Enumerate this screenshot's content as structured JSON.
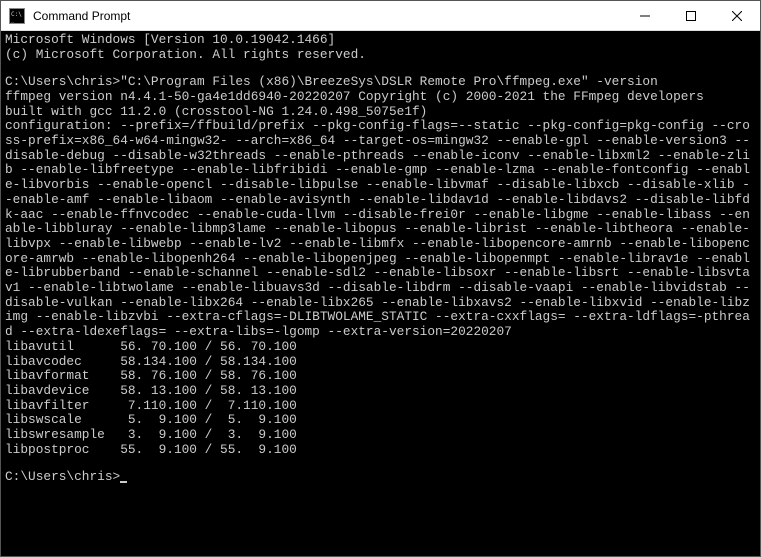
{
  "window": {
    "title": "Command Prompt",
    "icon_name": "cmd-icon"
  },
  "titlebar_controls": {
    "minimize": "minimize-button",
    "maximize": "maximize-button",
    "close": "close-button"
  },
  "terminal_lines": [
    "Microsoft Windows [Version 10.0.19042.1466]",
    "(c) Microsoft Corporation. All rights reserved.",
    "",
    "C:\\Users\\chris>\"C:\\Program Files (x86)\\BreezeSys\\DSLR Remote Pro\\ffmpeg.exe\" -version",
    "ffmpeg version n4.4.1-50-ga4e1dd6940-20220207 Copyright (c) 2000-2021 the FFmpeg developers",
    "built with gcc 11.2.0 (crosstool-NG 1.24.0.498_5075e1f)",
    "configuration: --prefix=/ffbuild/prefix --pkg-config-flags=--static --pkg-config=pkg-config --cross-prefix=x86_64-w64-mingw32- --arch=x86_64 --target-os=mingw32 --enable-gpl --enable-version3 --disable-debug --disable-w32threads --enable-pthreads --enable-iconv --enable-libxml2 --enable-zlib --enable-libfreetype --enable-libfribidi --enable-gmp --enable-lzma --enable-fontconfig --enable-libvorbis --enable-opencl --disable-libpulse --enable-libvmaf --disable-libxcb --disable-xlib --enable-amf --enable-libaom --enable-avisynth --enable-libdav1d --enable-libdavs2 --disable-libfdk-aac --enable-ffnvcodec --enable-cuda-llvm --disable-frei0r --enable-libgme --enable-libass --enable-libbluray --enable-libmp3lame --enable-libopus --enable-librist --enable-libtheora --enable-libvpx --enable-libwebp --enable-lv2 --enable-libmfx --enable-libopencore-amrnb --enable-libopencore-amrwb --enable-libopenh264 --enable-libopenjpeg --enable-libopenmpt --enable-librav1e --enable-librubberband --enable-schannel --enable-sdl2 --enable-libsoxr --enable-libsrt --enable-libsvtav1 --enable-libtwolame --enable-libuavs3d --disable-libdrm --disable-vaapi --enable-libvidstab --disable-vulkan --enable-libx264 --enable-libx265 --enable-libxavs2 --enable-libxvid --enable-libzimg --enable-libzvbi --extra-cflags=-DLIBTWOLAME_STATIC --extra-cxxflags= --extra-ldflags=-pthread --extra-ldexeflags= --extra-libs=-lgomp --extra-version=20220207",
    "libavutil      56. 70.100 / 56. 70.100",
    "libavcodec     58.134.100 / 58.134.100",
    "libavformat    58. 76.100 / 58. 76.100",
    "libavdevice    58. 13.100 / 58. 13.100",
    "libavfilter     7.110.100 /  7.110.100",
    "libswscale      5.  9.100 /  5.  9.100",
    "libswresample   3.  9.100 /  3.  9.100",
    "libpostproc    55.  9.100 / 55.  9.100",
    "",
    "C:\\Users\\chris>"
  ]
}
